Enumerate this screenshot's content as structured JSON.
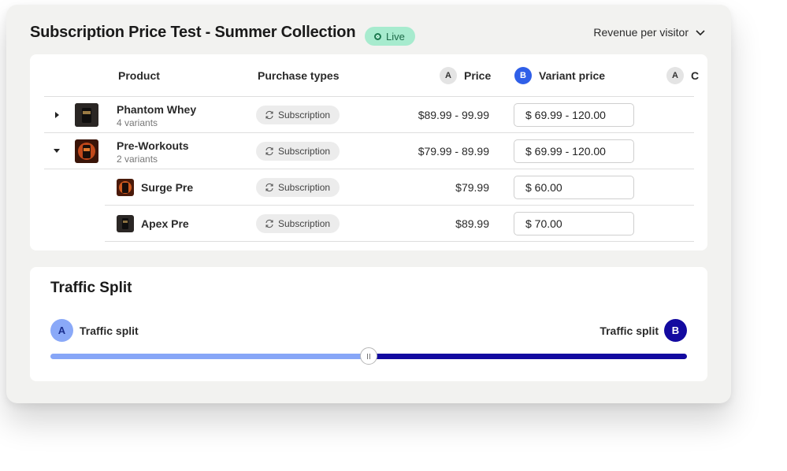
{
  "header": {
    "title": "Subscription Price Test - Summer Collection",
    "status_badge": "Live",
    "metric_dropdown": "Revenue per visitor"
  },
  "table": {
    "columns": {
      "product": "Product",
      "purchase_types": "Purchase types",
      "price_letter": "A",
      "price": "Price",
      "variant_letter": "B",
      "variant_price": "Variant price",
      "extra_letter": "A",
      "extra": "C"
    },
    "rows": [
      {
        "name": "Phantom Whey",
        "subtitle": "4 variants",
        "purchase_type": "Subscription",
        "price": "$89.99 - 99.99",
        "variant_price": "$ 69.99 - 120.00",
        "expander": "collapsed"
      },
      {
        "name": "Pre-Workouts",
        "subtitle": "2 variants",
        "purchase_type": "Subscription",
        "price": "$79.99 - 89.99",
        "variant_price": "$ 69.99 - 120.00",
        "expander": "expanded"
      },
      {
        "name": "Surge Pre",
        "subtitle": "",
        "purchase_type": "Subscription",
        "price": "$79.99",
        "variant_price": "$ 60.00"
      },
      {
        "name": "Apex Pre",
        "subtitle": "",
        "purchase_type": "Subscription",
        "price": "$89.99",
        "variant_price": "$ 70.00"
      }
    ]
  },
  "traffic": {
    "title": "Traffic Split",
    "label_a": "Traffic split",
    "letter_a": "A",
    "label_b": "Traffic split",
    "letter_b": "B",
    "split_a_fraction": 0.5
  },
  "colors": {
    "badge_live": "#a7ebce",
    "variant_b_blue": "#2f5fe8",
    "split_a": "#87a6f7",
    "split_b": "#130aa0"
  }
}
